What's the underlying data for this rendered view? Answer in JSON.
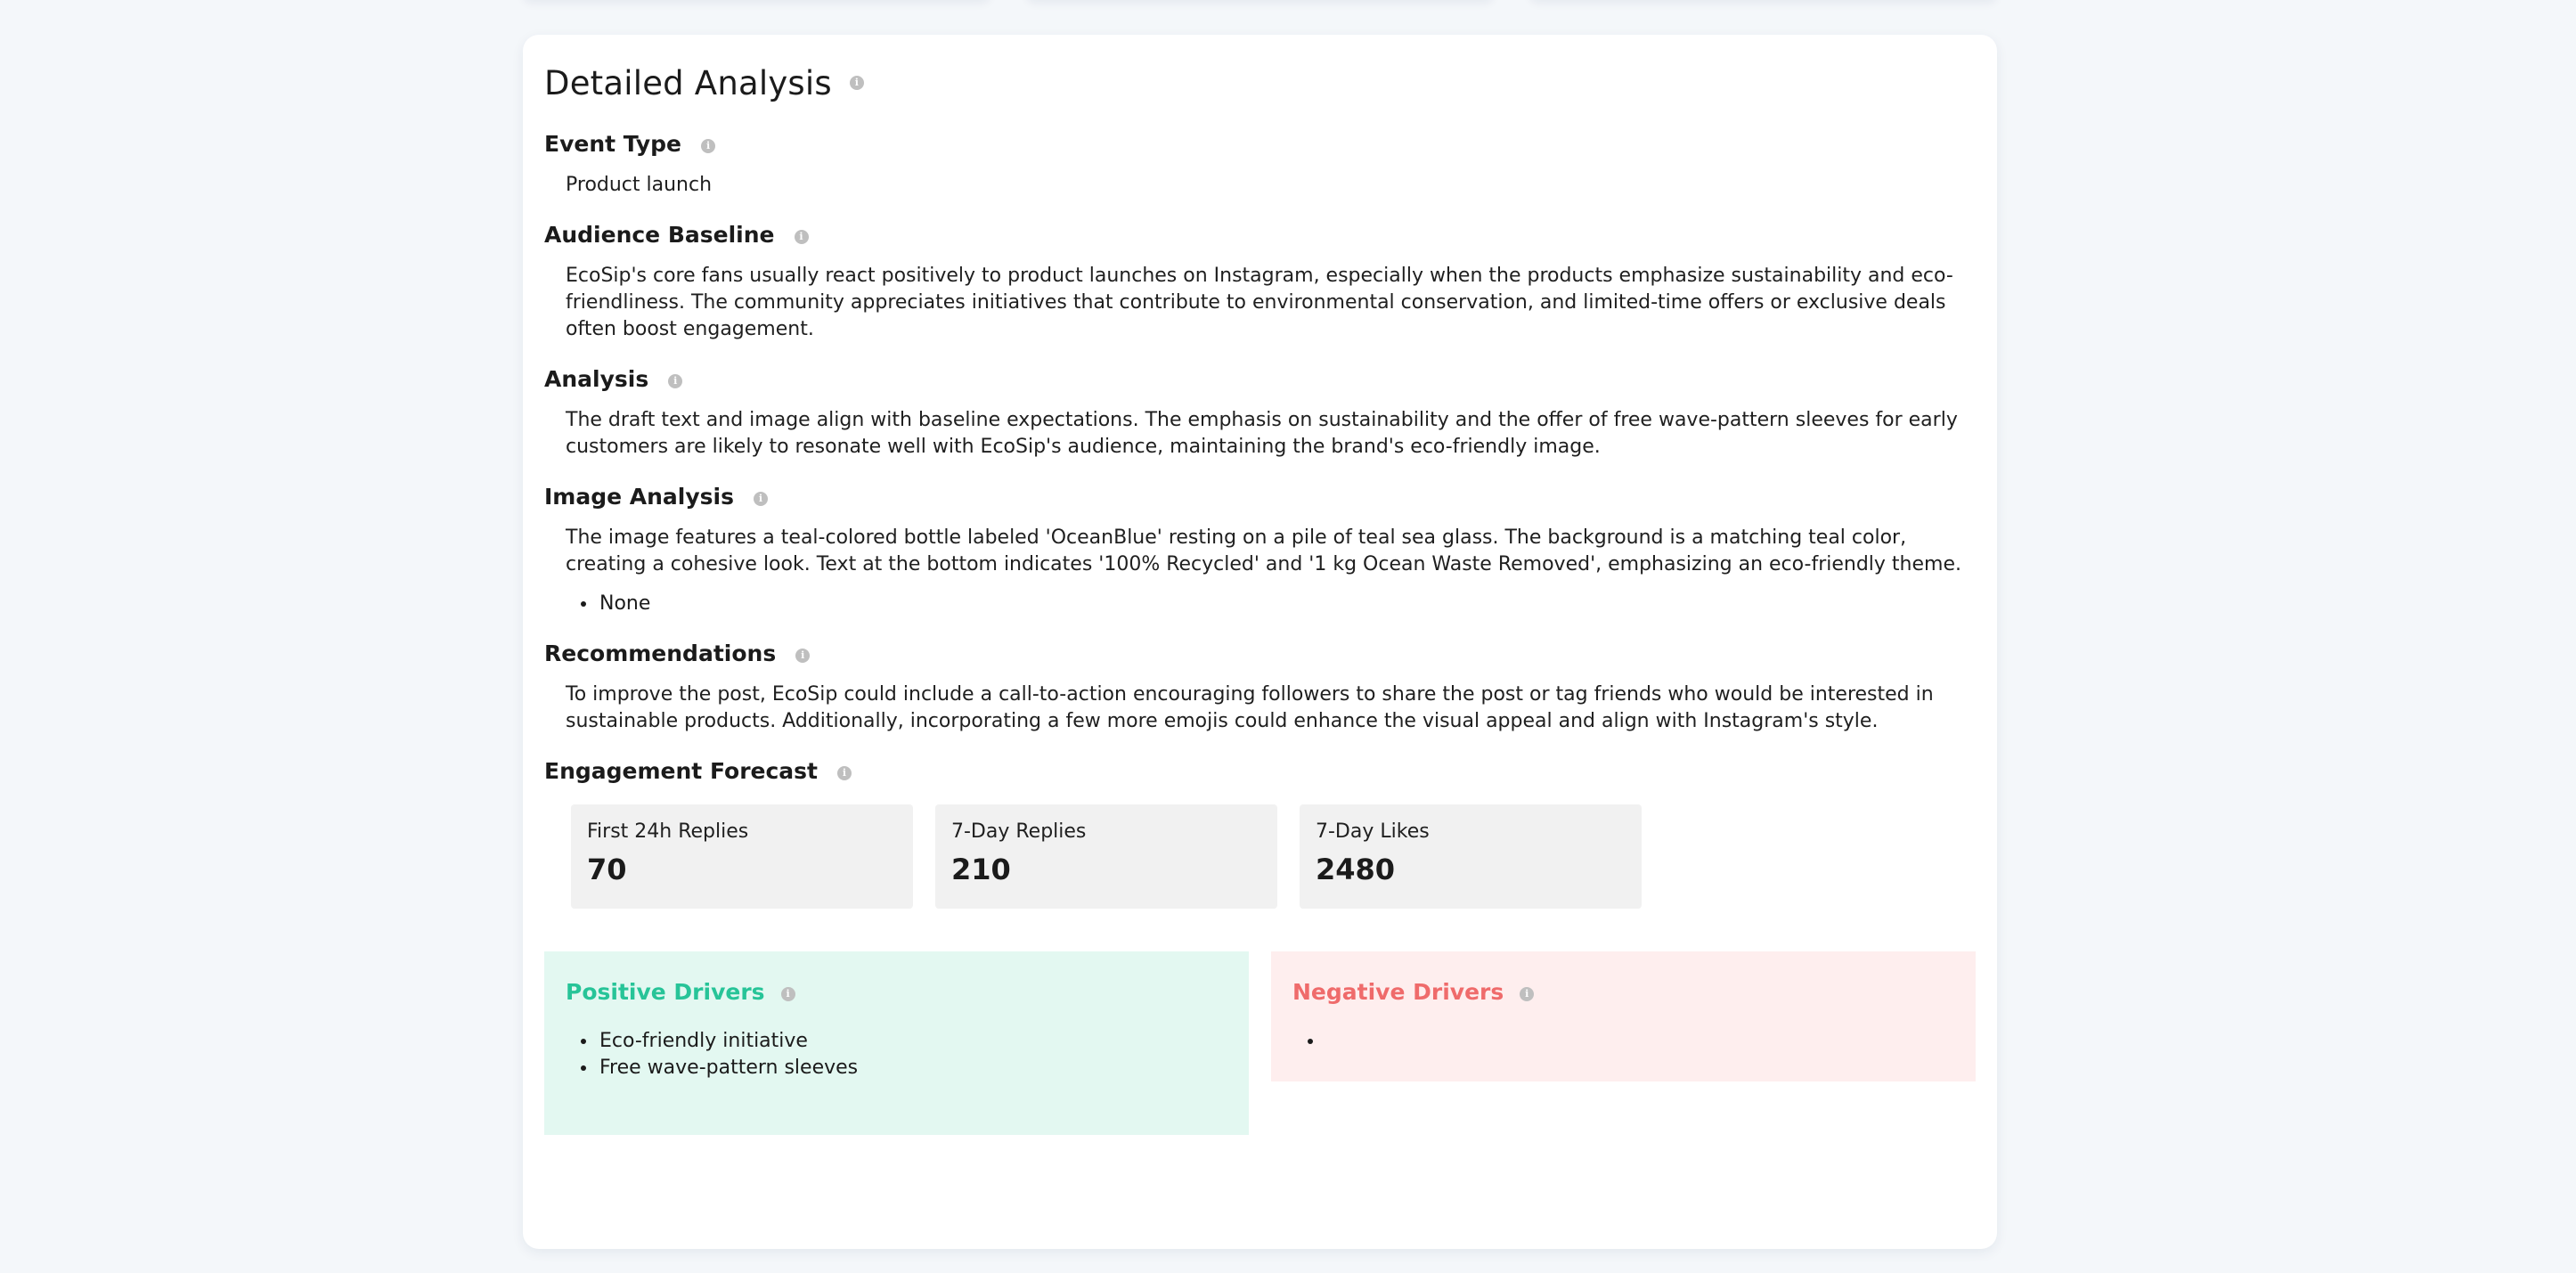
{
  "page": {
    "title": "Detailed Analysis",
    "info_glyph": "i"
  },
  "sections": {
    "event_type": {
      "label": "Event Type",
      "text": "Product launch"
    },
    "audience_baseline": {
      "label": "Audience Baseline",
      "text": "EcoSip's core fans usually react positively to product launches on Instagram, especially when the products emphasize sustainability and eco-friendliness. The community appreciates initiatives that contribute to environmental conservation, and limited-time offers or exclusive deals often boost engagement."
    },
    "analysis": {
      "label": "Analysis",
      "text": "The draft text and image align with baseline expectations. The emphasis on sustainability and the offer of free wave-pattern sleeves for early customers are likely to resonate well with EcoSip's audience, maintaining the brand's eco-friendly image."
    },
    "image_analysis": {
      "label": "Image Analysis",
      "text": "The image features a teal-colored bottle labeled 'OceanBlue' resting on a pile of teal sea glass. The background is a matching teal color, creating a cohesive look. Text at the bottom indicates '100% Recycled' and '1 kg Ocean Waste Removed', emphasizing an eco-friendly theme.",
      "bullets": [
        "None"
      ]
    },
    "recommendations": {
      "label": "Recommendations",
      "text": "To improve the post, EcoSip could include a call-to-action encouraging followers to share the post or tag friends who would be interested in sustainable products. Additionally, incorporating a few more emojis could enhance the visual appeal and align with Instagram's style."
    },
    "engagement_forecast": {
      "label": "Engagement Forecast",
      "metrics": [
        {
          "label": "First 24h Replies",
          "value": "70"
        },
        {
          "label": "7-Day Replies",
          "value": "210"
        },
        {
          "label": "7-Day Likes",
          "value": "2480"
        }
      ]
    }
  },
  "drivers": {
    "positive": {
      "label": "Positive Drivers",
      "items": [
        "Eco-friendly initiative",
        "Free wave-pattern sleeves"
      ]
    },
    "negative": {
      "label": "Negative Drivers",
      "items": [
        ""
      ]
    }
  },
  "icons": {
    "info": "info-icon"
  },
  "colors": {
    "positive_accent": "#27c498",
    "positive_bg": "#e3f8f1",
    "negative_accent": "#ef6b6b",
    "negative_bg": "#feeeee",
    "metric_bg": "#f1f1f1",
    "page_bg": "#f4f7fa"
  }
}
